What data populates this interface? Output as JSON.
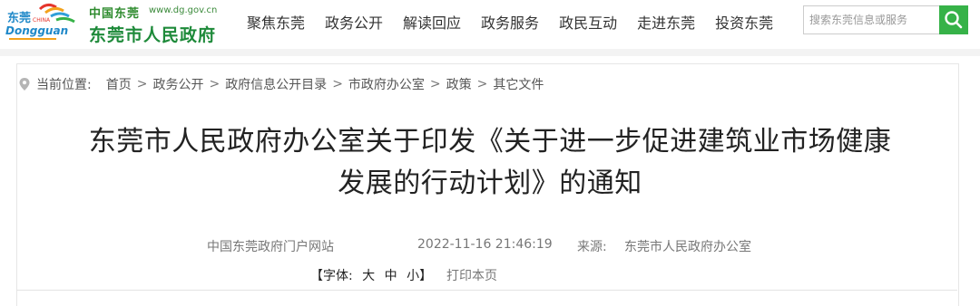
{
  "header": {
    "logo_cn_small": "中国东莞",
    "logo_url": "www.dg.gov.cn",
    "logo_title": "东莞市人民政府",
    "logo_mark_text": "东莞",
    "logo_mark_en": "Dongguan",
    "logo_mark_china": "CHINA",
    "nav": [
      "聚焦东莞",
      "政务公开",
      "解读回应",
      "政务服务",
      "政民互动",
      "走进东莞",
      "投资东莞"
    ],
    "search_placeholder": "搜索东莞信息或服务",
    "accent_color": "#36b248"
  },
  "breadcrumb": {
    "prefix": "当前位置:",
    "items": [
      "首页",
      "政务公开",
      "政府信息公开目录",
      "市政府办公室",
      "政策",
      "其它文件"
    ],
    "separator": ">"
  },
  "article": {
    "title_line1": "东莞市人民政府办公室关于印发《关于进一步促进建筑业市场健康",
    "title_line2": "发展的行动计划》的通知",
    "site": "中国东莞政府门户网站",
    "datetime": "2022-11-16 21:46:19",
    "source_label": "来源:",
    "source": "东莞市人民政府办公室",
    "font_label": "【字体:",
    "font_large": "大",
    "font_medium": "中",
    "font_small": "小】",
    "print": "打印本页"
  }
}
